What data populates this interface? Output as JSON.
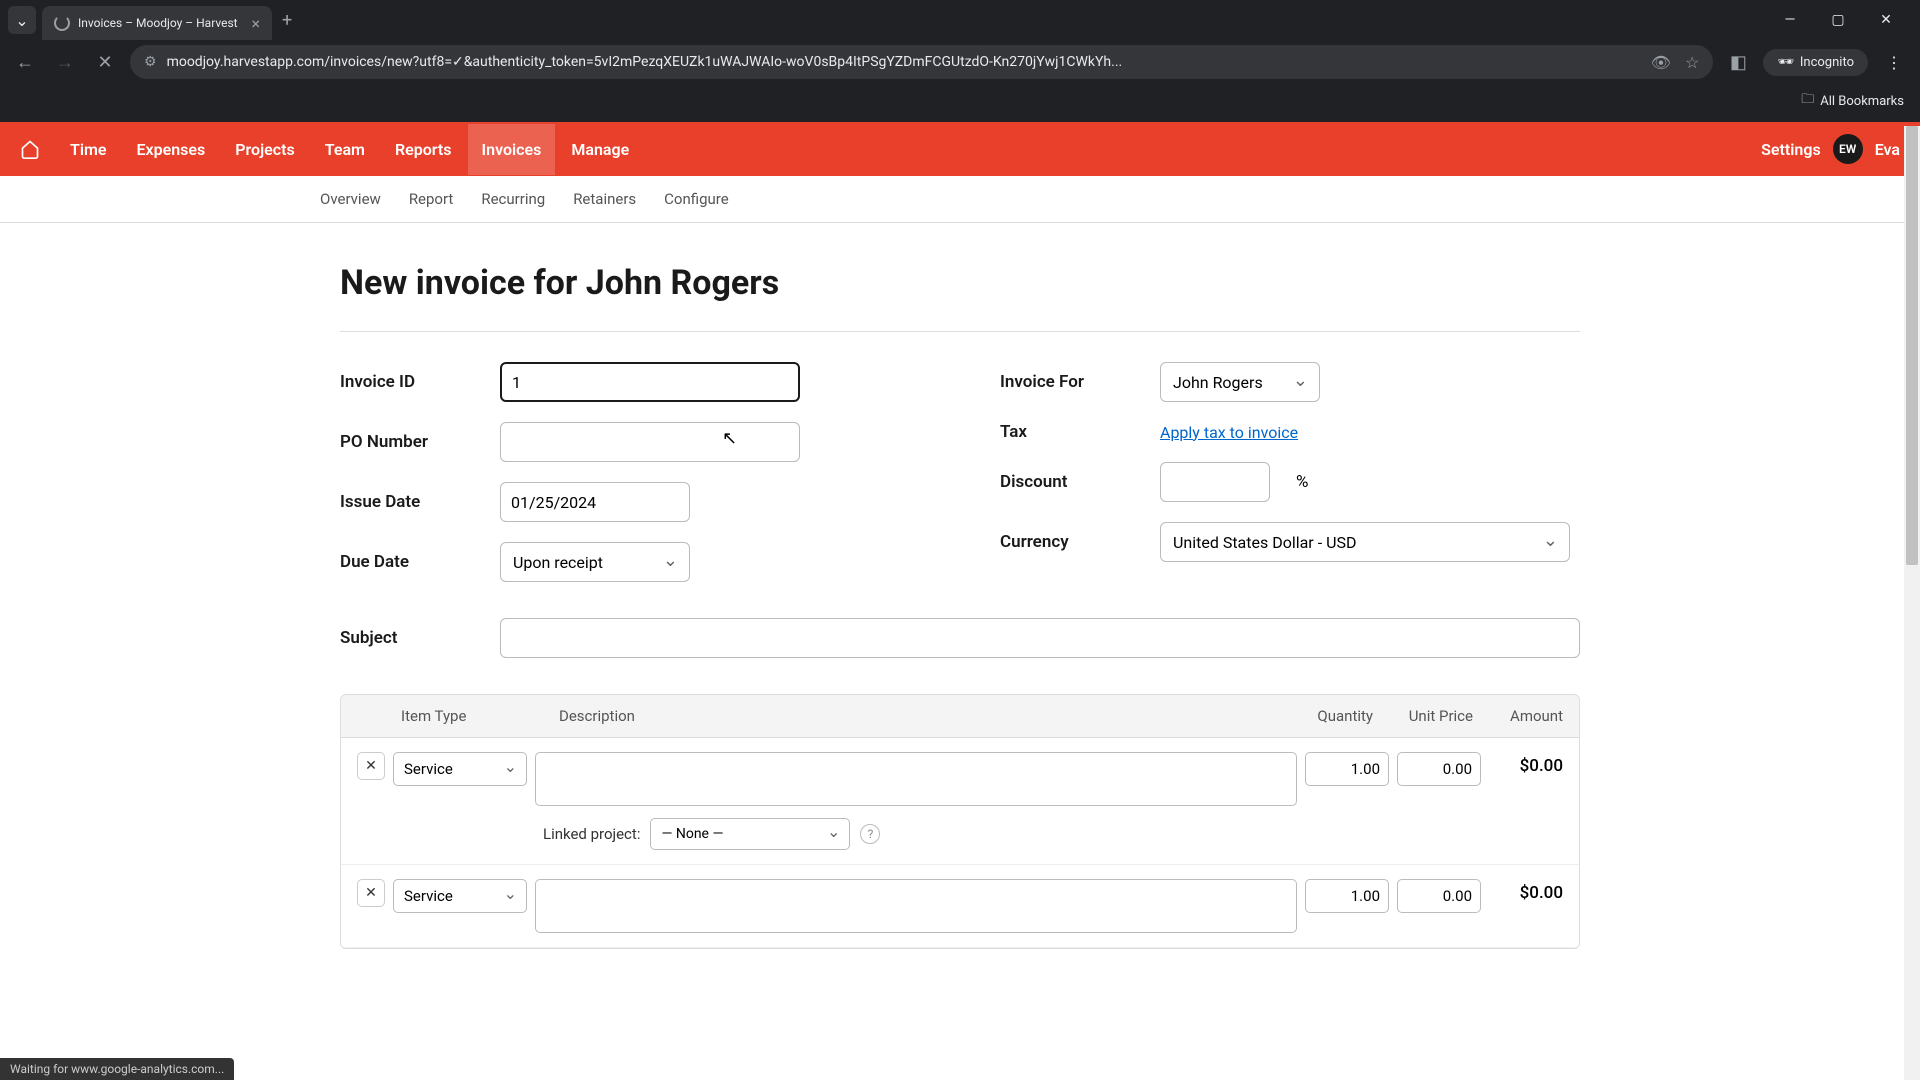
{
  "browser": {
    "tab_title": "Invoices – Moodjoy – Harvest",
    "url": "moodjoy.harvestapp.com/invoices/new?utf8=✓&authenticity_token=5vI2mPezqXEUZk1uWAJWAIo-woV0sBp4ItPSgYZDmFCGUtzdO-Kn270jYwj1CWkYh...",
    "incognito_label": "Incognito",
    "all_bookmarks_label": "All Bookmarks"
  },
  "nav": {
    "items": [
      "Time",
      "Expenses",
      "Projects",
      "Team",
      "Reports",
      "Invoices",
      "Manage"
    ],
    "active_index": 5,
    "settings": "Settings",
    "avatar_initials": "EW",
    "username": "Eva"
  },
  "subnav": {
    "items": [
      "Overview",
      "Report",
      "Recurring",
      "Retainers",
      "Configure"
    ]
  },
  "page": {
    "title": "New invoice for John Rogers"
  },
  "form": {
    "invoice_id": {
      "label": "Invoice ID",
      "value": "1"
    },
    "po_number": {
      "label": "PO Number",
      "value": ""
    },
    "issue_date": {
      "label": "Issue Date",
      "value": "01/25/2024"
    },
    "due_date": {
      "label": "Due Date",
      "value": "Upon receipt"
    },
    "invoice_for": {
      "label": "Invoice For",
      "value": "John Rogers"
    },
    "tax": {
      "label": "Tax",
      "link": "Apply tax to invoice"
    },
    "discount": {
      "label": "Discount",
      "value": "",
      "unit": "%"
    },
    "currency": {
      "label": "Currency",
      "value": "United States Dollar - USD"
    },
    "subject": {
      "label": "Subject",
      "value": ""
    }
  },
  "table": {
    "headers": {
      "type": "Item Type",
      "desc": "Description",
      "qty": "Quantity",
      "price": "Unit Price",
      "amount": "Amount"
    },
    "linked_label": "Linked project:",
    "linked_none": "— None —",
    "rows": [
      {
        "type": "Service",
        "desc": "",
        "qty": "1.00",
        "price": "0.00",
        "amount": "$0.00"
      },
      {
        "type": "Service",
        "desc": "",
        "qty": "1.00",
        "price": "0.00",
        "amount": "$0.00"
      }
    ]
  },
  "status": "Waiting for www.google-analytics.com..."
}
